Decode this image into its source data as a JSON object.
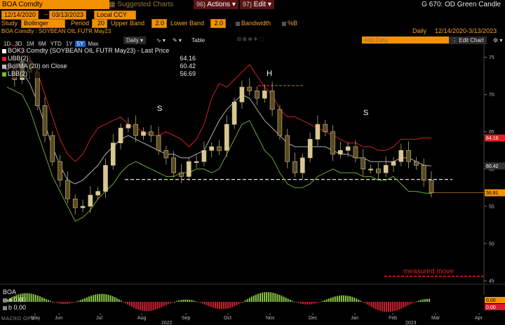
{
  "header": {
    "security": "BOA Comdty",
    "suggested": "Suggested Charts",
    "actions_num": "96)",
    "actions": "Actions",
    "edit_num": "97)",
    "edit": "Edit",
    "right_title": "G 670: OD Green Candle"
  },
  "params": {
    "date_from": "12/14/2020",
    "date_to": "03/13/2023",
    "currency": "Local CCY",
    "study_label": "Study",
    "study_value": "Bollinger",
    "period_label": "Period",
    "period_value": "20",
    "upper_label": "Upper Band",
    "upper_value": "2.0",
    "lower_label": "Lower Band",
    "lower_value": "2.0",
    "bandwidth_label": "Bandwidth",
    "pctb_label": "%B"
  },
  "info": {
    "security_desc": "BOA Comdty : SOYBEAN OIL FUTR  May23",
    "freq": "Daily",
    "range": "12/14/2020-3/13/2023"
  },
  "toolbar": {
    "periods": [
      "1D",
      "3D",
      "1M",
      "6M",
      "YTD",
      "1Y",
      "5Y",
      "Max"
    ],
    "active_period": "5Y",
    "freq_select": "Daily",
    "table": "Table",
    "add_data_placeholder": "Add Data",
    "edit_chart": "Edit Chart"
  },
  "legend": {
    "rows": [
      {
        "label": "BOK3 Comdty  (SOYBEAN OIL FUTR  May23) - Last Price",
        "value": "",
        "color": "#ffffff"
      },
      {
        "label": "UBB(2)",
        "value": "64.16",
        "color": "#e02020"
      },
      {
        "label": "BollMA (20)  on Close",
        "value": "60.42",
        "color": "#bbbbbb"
      },
      {
        "label": "LBB(2)",
        "value": "56.69",
        "color": "#7ab83a"
      }
    ]
  },
  "annotations": {
    "left_shoulder": "S",
    "head": "H",
    "right_shoulder": "S",
    "measured_move": "measured move",
    "watermark": "MACRO OPS"
  },
  "lower_panel": {
    "title": "BOA",
    "a_label": "a",
    "a_value": "0.00",
    "b_label": "b",
    "b_value": "0.00",
    "tag_a": "0.00",
    "tag_b": "0.00"
  },
  "chart_data": {
    "type": "line",
    "title": "BOK3 Comdty (SOYBEAN OIL FUTR May23) - Last Price",
    "ylim": [
      45,
      76
    ],
    "y_ticks": [
      45,
      50,
      55,
      60,
      65,
      70,
      75
    ],
    "x_ticks": [
      "May",
      "Jun",
      "Jul",
      "Aug",
      "Sep",
      "Oct",
      "Nov",
      "Dec",
      "Jan",
      "Feb",
      "Mar",
      "Apr"
    ],
    "x_years": [
      "2022",
      "2023"
    ],
    "series": [
      {
        "name": "Last Price",
        "color": "#e6d8a6",
        "values": [
          73.5,
          72.0,
          74.5,
          73.0,
          68.5,
          64.5,
          61.0,
          58.5,
          56.0,
          54.8,
          55.0,
          56.5,
          57.0,
          60.5,
          63.5,
          65.5,
          66.0,
          64.5,
          65.0,
          64.5,
          62.5,
          61.5,
          59.5,
          59.0,
          61.0,
          61.0,
          62.5,
          63.0,
          62.5,
          66.0,
          69.0,
          71.0,
          70.5,
          69.5,
          70.5,
          68.0,
          64.5,
          61.0,
          59.5,
          61.5,
          64.0,
          66.0,
          65.0,
          62.0,
          62.5,
          63.0,
          61.5,
          60.0,
          60.0,
          59.5,
          60.5,
          61.0,
          62.5,
          61.0,
          60.5,
          58.5,
          56.8
        ]
      },
      {
        "name": "UBB(2)",
        "color": "#d02020",
        "values": [
          77.0,
          76.5,
          76.0,
          75.0,
          73.0,
          70.0,
          67.0,
          64.0,
          62.0,
          61.0,
          62.0,
          64.0,
          65.5,
          66.0,
          66.5,
          67.0,
          66.0,
          65.5,
          65.0,
          64.5,
          64.5,
          65.0,
          64.5,
          64.0,
          63.0,
          64.0,
          66.0,
          69.5,
          71.5,
          71.0,
          72.0,
          73.0,
          74.0,
          72.5,
          71.0,
          70.0,
          68.0,
          67.0,
          67.0,
          66.5,
          66.0,
          65.5,
          65.0,
          64.5,
          64.0,
          63.5,
          63.5,
          63.0,
          63.0,
          62.5,
          62.5,
          63.0,
          64.0,
          64.0,
          64.0,
          64.2,
          64.16
        ]
      },
      {
        "name": "BollMA (20) on Close",
        "color": "#b0b0b0",
        "values": [
          74.0,
          73.5,
          73.0,
          71.5,
          69.0,
          66.0,
          63.0,
          60.5,
          58.5,
          58.0,
          58.5,
          59.5,
          60.5,
          62.0,
          63.0,
          64.0,
          64.5,
          64.0,
          63.5,
          63.0,
          62.5,
          62.0,
          62.0,
          61.5,
          61.5,
          62.0,
          62.5,
          64.5,
          66.5,
          68.0,
          69.0,
          70.0,
          69.5,
          68.0,
          66.5,
          65.5,
          64.5,
          63.5,
          63.0,
          63.0,
          63.0,
          63.0,
          63.0,
          62.5,
          62.0,
          62.0,
          61.5,
          61.5,
          61.0,
          61.0,
          61.0,
          61.0,
          61.5,
          61.5,
          61.0,
          60.5,
          60.42
        ]
      },
      {
        "name": "LBB(2)",
        "color": "#6aa832",
        "values": [
          71.0,
          70.5,
          70.0,
          68.0,
          65.0,
          62.0,
          59.0,
          57.0,
          55.0,
          53.0,
          53.5,
          54.5,
          56.0,
          57.0,
          58.0,
          59.5,
          60.5,
          61.0,
          60.5,
          60.0,
          59.5,
          59.0,
          59.0,
          59.5,
          59.5,
          60.0,
          60.0,
          59.5,
          60.0,
          62.0,
          64.0,
          66.0,
          66.5,
          64.5,
          62.5,
          61.5,
          59.5,
          58.0,
          57.5,
          57.5,
          58.0,
          59.0,
          59.5,
          60.0,
          59.5,
          59.5,
          59.5,
          59.0,
          59.0,
          58.5,
          58.5,
          59.0,
          58.0,
          57.0,
          57.0,
          56.8,
          56.69
        ]
      }
    ],
    "lines": {
      "neckline": 58.6,
      "head_top": 71.2,
      "measured_move": 45.6,
      "current_price": 56.81
    },
    "price_tags": [
      {
        "value": 64.16,
        "label": "64.16",
        "bg": "#e02020",
        "fg": "#ffffff"
      },
      {
        "value": 60.42,
        "label": "60.42",
        "bg": "#333333",
        "fg": "#ffffff"
      },
      {
        "value": 56.81,
        "label": "56.81",
        "bg": "#f39200",
        "fg": "#000000"
      }
    ]
  }
}
